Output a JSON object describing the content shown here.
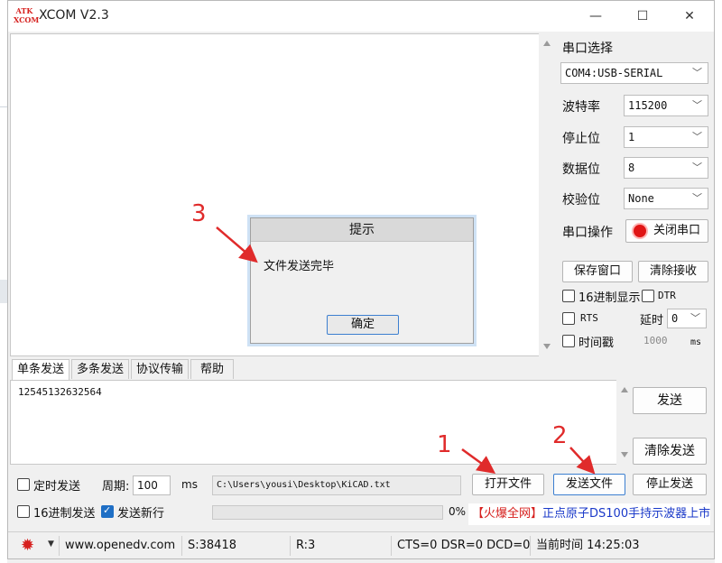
{
  "window": {
    "logo_top": "ATK",
    "logo_bottom": "XCOM",
    "title": "XCOM V2.3",
    "minimize": "—",
    "maximize": "☐",
    "close": "✕"
  },
  "dialog": {
    "title": "提示",
    "message": "文件发送完毕",
    "ok_label": "确定"
  },
  "serial": {
    "port_label": "串口选择",
    "port_value": "COM4:USB-SERIAL",
    "baud_label": "波特率",
    "baud_value": "115200",
    "stop_label": "停止位",
    "stop_value": "1",
    "data_label": "数据位",
    "data_value": "8",
    "parity_label": "校验位",
    "parity_value": "None",
    "op_label": "串口操作",
    "close_port_label": "关闭串口"
  },
  "recv_options": {
    "save_window": "保存窗口",
    "clear_recv": "清除接收",
    "hex_display": "16进制显示",
    "dtr": "DTR",
    "rts": "RTS",
    "delay_label": "延时",
    "delay_value": "0",
    "timestamp": "时间戳",
    "timestamp_value": "1000",
    "timestamp_unit": "ms"
  },
  "tabs": [
    {
      "label": "单条发送"
    },
    {
      "label": "多条发送"
    },
    {
      "label": "协议传输"
    },
    {
      "label": "帮助"
    }
  ],
  "send": {
    "text": "12545132632564",
    "send_label": "发送",
    "clear_send": "清除发送",
    "timed_send": "定时发送",
    "period_label": "周期:",
    "period_value": "100",
    "period_unit": "ms",
    "file_path": "C:\\Users\\yousi\\Desktop\\KiCAD.txt",
    "open_file": "打开文件",
    "send_file": "发送文件",
    "stop_send": "停止发送",
    "hex_send": "16进制发送",
    "newline": "发送新行",
    "progress_text": "0%",
    "progress": 0
  },
  "ad": {
    "bracket_text": "【火爆全网】",
    "text": "正点原子DS100手持示波器上市"
  },
  "status": {
    "url": "www.openedv.com",
    "sent": "S:38418",
    "received": "R:3",
    "lines": "CTS=0 DSR=0 DCD=0",
    "time": "当前时间 14:25:03"
  },
  "annotations": {
    "one": "1",
    "two": "2",
    "three": "3"
  },
  "colors": {
    "accent": "#1f6fc5",
    "annotation": "#e02b2b",
    "ad_text": "#1a39c9",
    "ad_bracket": "#d6201e"
  }
}
